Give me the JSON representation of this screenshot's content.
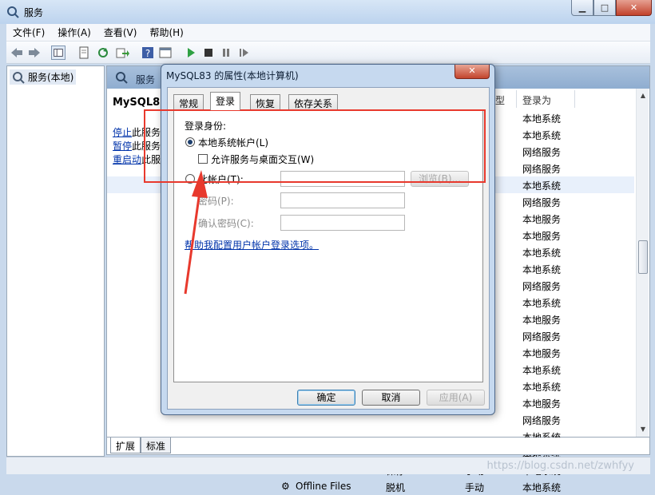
{
  "window": {
    "title": "服务"
  },
  "menu": [
    "文件(F)",
    "操作(A)",
    "查看(V)",
    "帮助(H)"
  ],
  "tree": {
    "root": "服务(本地)"
  },
  "pane_header": "服务",
  "detail": {
    "name": "MySQL83",
    "stop_link": "停止",
    "stop_rest": "此服务",
    "pause_link": "暂停",
    "pause_rest": "此服务",
    "restart_link": "重启动",
    "restart_rest": "此服务"
  },
  "columns": {
    "type_partial": "型",
    "logon_as": "登录为"
  },
  "logon_values": [
    "本地系统",
    "本地系统",
    "网络服务",
    "网络服务",
    "本地系统",
    "网络服务",
    "本地服务",
    "本地服务",
    "本地系统",
    "本地系统",
    "网络服务",
    "本地系统",
    "本地服务",
    "网络服务",
    "本地服务",
    "本地系统",
    "本地系统",
    "本地服务",
    "网络服务",
    "本地系统",
    "本地系统"
  ],
  "partial_rows": [
    {
      "name": "Office Source En...",
      "status": "保存...",
      "start": "手动",
      "logon": "本地系统"
    },
    {
      "name": "Offline Files",
      "status": "脱机",
      "start": "手动",
      "logon": "本地系统"
    }
  ],
  "bottom_tabs": [
    "扩展",
    "标准"
  ],
  "watermark": "https://blog.csdn.net/zwhfyy",
  "dialog": {
    "title": "MySQL83 的属性(本地计算机)",
    "close": "✕",
    "tabs": [
      "常规",
      "登录",
      "恢复",
      "依存关系"
    ],
    "active_tab": "登录",
    "logon_as_label": "登录身份:",
    "local_system_label": "本地系统帐户(L)",
    "local_system_selected": true,
    "interact_label": "允许服务与桌面交互(W)",
    "interact_checked": false,
    "this_account_label": "此帐户(T):",
    "browse_label": "浏览(B)...",
    "password_label": "密码(P):",
    "confirm_label": "确认密码(C):",
    "help_link": "帮助我配置用户帐户登录选项。",
    "ok": "确定",
    "cancel": "取消",
    "apply": "应用(A)"
  },
  "colors": {
    "annotation": "#e8392d",
    "link": "#0033aa"
  }
}
